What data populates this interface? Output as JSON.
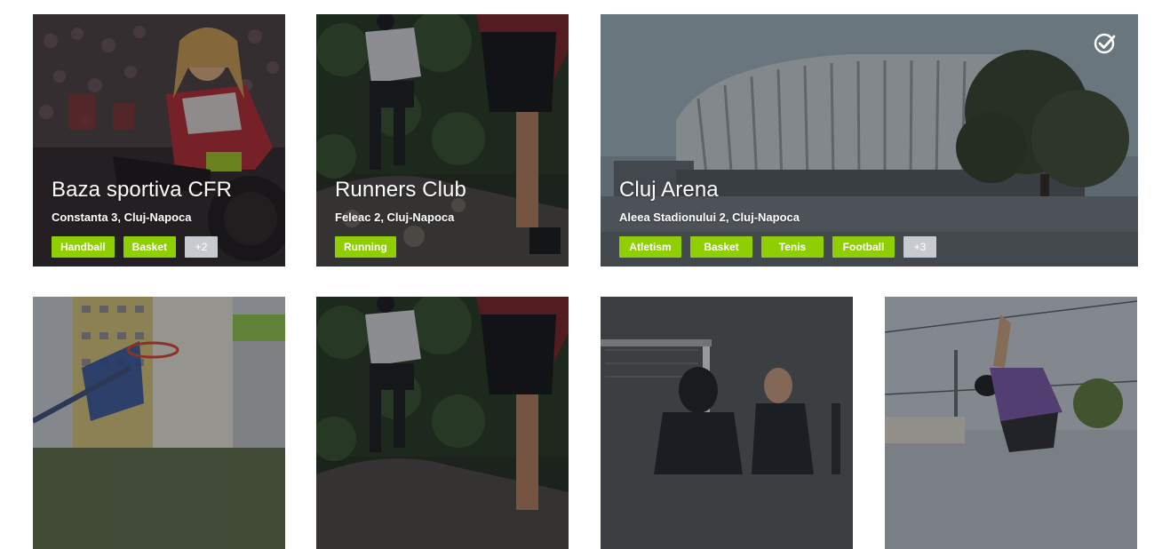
{
  "cards": [
    {
      "title": "Baza sportiva CFR",
      "address": "Constanta 3, Cluj-Napoca",
      "tags": [
        "Handball",
        "Basket"
      ],
      "more": "+2",
      "image": "wheelchair-player-photo"
    },
    {
      "title": "Runners Club",
      "address": "Feleac 2, Cluj-Napoca",
      "tags": [
        "Running"
      ],
      "image": "trail-runners-photo"
    },
    {
      "title": "Cluj Arena",
      "address": "Aleea Stadionului 2, Cluj-Napoca",
      "tags": [
        "Atletism",
        "Basket",
        "Tenis",
        "Football"
      ],
      "more": "+3",
      "verified": true,
      "image": "stadium-photo"
    },
    {
      "image": "basketball-hoop-photo"
    },
    {
      "image": "trail-runners-photo"
    },
    {
      "image": "fencing-gym-photo"
    },
    {
      "image": "street-jumper-photo"
    }
  ],
  "colors": {
    "tag_green": "#8fce00",
    "tag_more": "#c7cbd0",
    "overlay": "#14181a"
  }
}
